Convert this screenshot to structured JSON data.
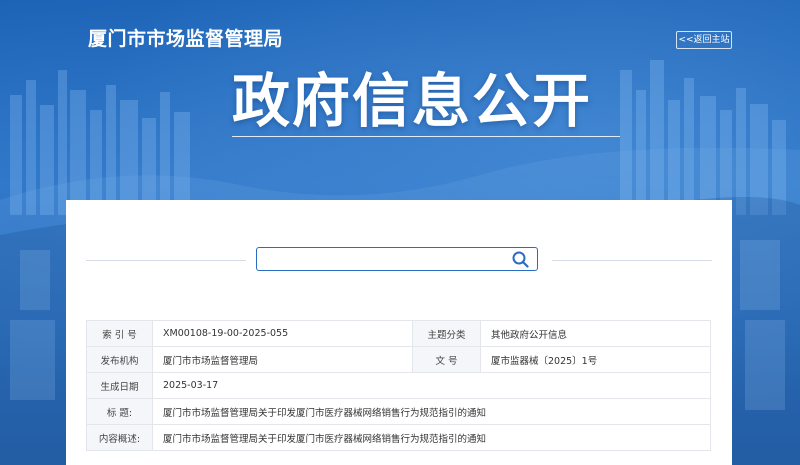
{
  "header": {
    "site_title": "厦门市市场监督管理局",
    "back_home": "<<返回主站",
    "big_title": "政府信息公开"
  },
  "search": {
    "value": "",
    "placeholder": "",
    "icon": "search-icon"
  },
  "info": {
    "index_label": "索 引 号",
    "index_value": "XM00108-19-00-2025-055",
    "category_label": "主题分类",
    "category_value": "其他政府公开信息",
    "publisher_label": "发布机构",
    "publisher_value": "厦门市市场监督管理局",
    "docno_label": "文 号",
    "docno_value": "厦市监器械〔2025〕1号",
    "date_label": "生成日期",
    "date_value": "2025-03-17",
    "title_label": "标 题:",
    "title_value": "厦门市市场监督管理局关于印发厦门市医疗器械网络销售行为规范指引的通知",
    "summary_label": "内容概述:",
    "summary_value": "厦门市市场监督管理局关于印发厦门市医疗器械网络销售行为规范指引的通知"
  },
  "colors": {
    "brand_blue": "#1b62b6",
    "border_blue": "#2a6cc0"
  }
}
